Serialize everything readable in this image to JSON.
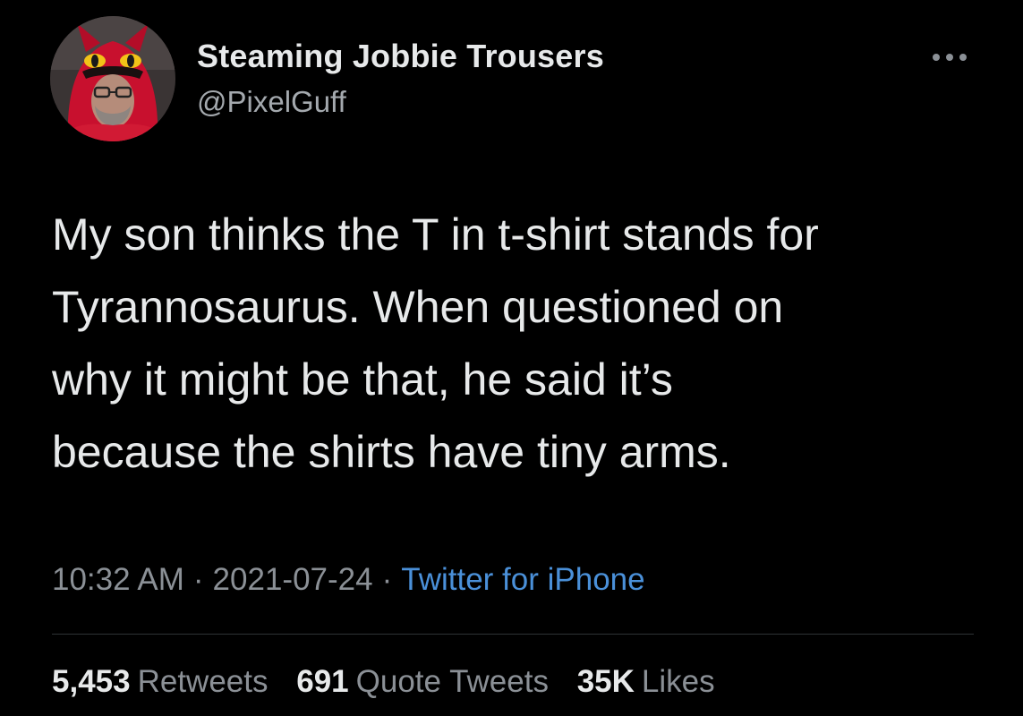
{
  "author": {
    "display_name": "Steaming Jobbie Trousers",
    "handle": "@PixelGuff",
    "avatar_icon": "profile-photo"
  },
  "menu_icon": "more-dots-icon",
  "tweet": {
    "text": "My son thinks the T in t-shirt stands for\nTyrannosaurus. When questioned on\nwhy it might be that, he said it’s\nbecause the shirts have tiny arms."
  },
  "meta": {
    "time": "10:32 AM",
    "separator": "·",
    "date": "2021-07-24",
    "source": "Twitter for iPhone"
  },
  "stats": {
    "retweets": {
      "count": "5,453",
      "label": "Retweets"
    },
    "quotes": {
      "count": "691",
      "label": "Quote Tweets"
    },
    "likes": {
      "count": "35K",
      "label": "Likes"
    }
  },
  "colors": {
    "background": "#000000",
    "primary_text": "#e7e9ea",
    "secondary_text": "#8b9096",
    "link": "#4a90d9",
    "divider": "#2f3336"
  }
}
